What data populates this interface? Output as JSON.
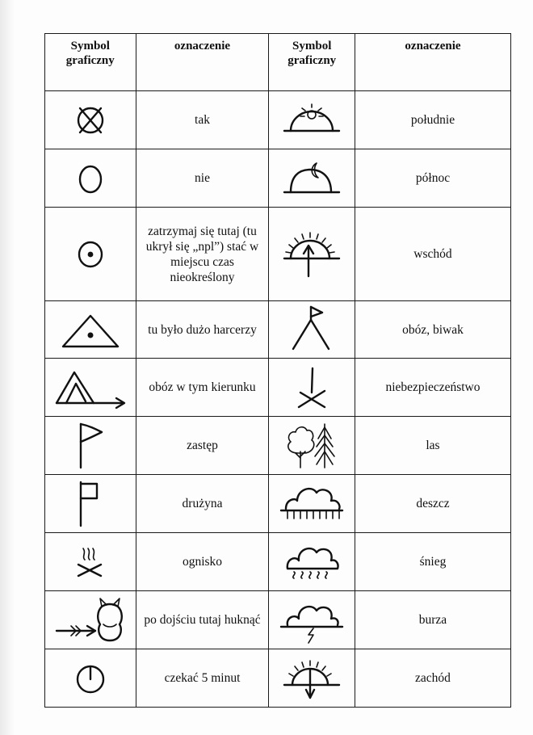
{
  "headers": {
    "symbol": "Symbol graficzny",
    "meaning": "oznaczenie"
  },
  "rows": [
    {
      "left": {
        "icon": "circle-cross-icon",
        "label": "tak"
      },
      "right": {
        "icon": "sunrise-noon-icon",
        "label": "południe"
      }
    },
    {
      "left": {
        "icon": "circle-icon",
        "label": "nie"
      },
      "right": {
        "icon": "moon-hill-icon",
        "label": "północ"
      }
    },
    {
      "left": {
        "icon": "circle-dot-icon",
        "label": "zatrzymaj się tutaj (tu ukrył się „npl”) stać w miejscu czas nieokreślony"
      },
      "right": {
        "icon": "sun-arrow-up-icon",
        "label": "wschód"
      }
    },
    {
      "left": {
        "icon": "triangle-dot-icon",
        "label": "tu było dużo harcerzy"
      },
      "right": {
        "icon": "triangle-flag-icon",
        "label": "obóz, biwak"
      }
    },
    {
      "left": {
        "icon": "tent-arrow-icon",
        "label": "obóz w tym kierunku"
      },
      "right": {
        "icon": "danger-cross-icon",
        "label": "niebezpieczeństwo"
      }
    },
    {
      "left": {
        "icon": "pennant-flag-icon",
        "label": "zastęp"
      },
      "right": {
        "icon": "trees-icon",
        "label": "las"
      }
    },
    {
      "left": {
        "icon": "square-flag-icon",
        "label": "drużyna"
      },
      "right": {
        "icon": "rain-cloud-icon",
        "label": "deszcz"
      }
    },
    {
      "left": {
        "icon": "campfire-icon",
        "label": "ognisko"
      },
      "right": {
        "icon": "snow-cloud-icon",
        "label": "śnieg"
      }
    },
    {
      "left": {
        "icon": "owl-arrow-icon",
        "label": "po dojściu tutaj huknąć"
      },
      "right": {
        "icon": "storm-cloud-icon",
        "label": "burza"
      }
    },
    {
      "left": {
        "icon": "clock-icon",
        "label": "czekać 5 minut"
      },
      "right": {
        "icon": "sun-arrow-down-icon",
        "label": "zachód"
      }
    }
  ]
}
